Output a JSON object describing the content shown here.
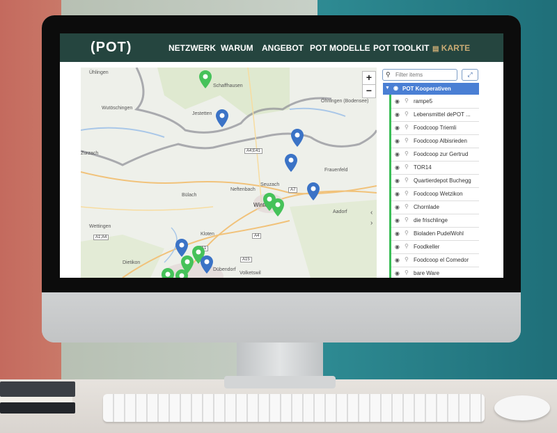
{
  "nav": {
    "logo": "(POT)",
    "items": [
      "NETZWERK",
      "WARUM",
      "ANGEBOT",
      "POT MODELLE",
      "POT TOOLKIT",
      "KARTE"
    ],
    "active_index": 5
  },
  "map": {
    "zoom_in": "+",
    "zoom_out": "−",
    "places": [
      "Ühlingen",
      "Schaffhausen",
      "Wutöschingen",
      "Jestetten",
      "Öhningen (Bodensee)",
      "Zurzach",
      "Frauenfeld",
      "Neftenbach",
      "Seuzach",
      "Bülach",
      "Wettingen",
      "Kloten",
      "Dietikon",
      "Dübendorf",
      "Volketswil",
      "Aadorf",
      "Winterthur"
    ],
    "roads": [
      "A4;E41",
      "A7",
      "A1;A4",
      "A4",
      "A1",
      "A15"
    ],
    "pin_colors": {
      "blue": "#3b73c6",
      "green": "#46c25a"
    }
  },
  "panel": {
    "search_placeholder": "Filter items",
    "expand_icon": "expand-icon",
    "group_label": "POT Kooperativen",
    "items": [
      "rampe5",
      "Lebensmittel dePOT ...",
      "Foodcoop Triemli",
      "Foodcoop Albisrieden",
      "Foodcoop zur Gertrud",
      "TOR14",
      "Quartierdepot Buchegg",
      "Foodcoop Wetzikon",
      "Chornlade",
      "die frischlinge",
      "Bioladen PudelWohl",
      "Foodkeller",
      "Foodcoop el Comedor",
      "bare Ware"
    ]
  },
  "colors": {
    "navbar": "#25453f",
    "active_nav": "#c9ab74",
    "group_bg": "#4a7fd4",
    "rail": "#3bbd57"
  }
}
